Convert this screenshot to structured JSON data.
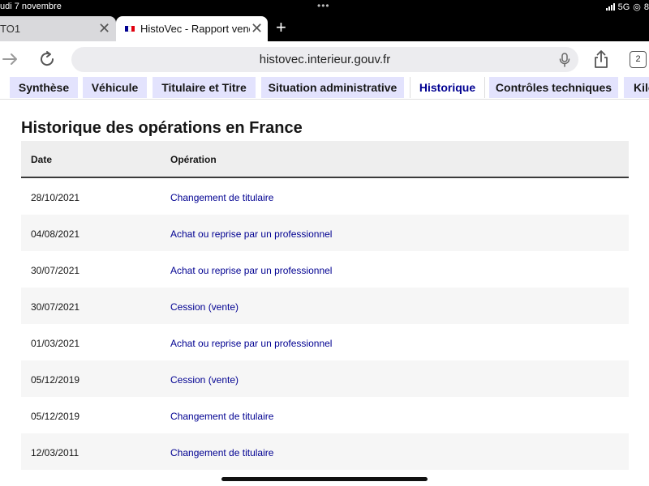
{
  "status": {
    "time_date": "udi 7 novembre",
    "network": "5G",
    "battery_fragment": "8"
  },
  "browser": {
    "tabs": [
      {
        "label": "TO1"
      },
      {
        "label": "HistoVec - Rapport vende"
      }
    ],
    "url": "histovec.interieur.gouv.fr",
    "tab_count": "2"
  },
  "nav": {
    "tabs": [
      {
        "label": "Synthèse"
      },
      {
        "label": "Véhicule"
      },
      {
        "label": "Titulaire et Titre"
      },
      {
        "label": "Situation administrative"
      },
      {
        "label": "Historique",
        "active": true
      },
      {
        "label": "Contrôles techniques"
      },
      {
        "label": "Kilo"
      }
    ]
  },
  "main": {
    "title": "Historique des opérations en France",
    "table": {
      "headers": [
        "Date",
        "Opération"
      ],
      "rows": [
        {
          "date": "28/10/2021",
          "operation": "Changement de titulaire"
        },
        {
          "date": "04/08/2021",
          "operation": "Achat ou reprise par un professionnel"
        },
        {
          "date": "30/07/2021",
          "operation": "Achat ou reprise par un professionnel"
        },
        {
          "date": "30/07/2021",
          "operation": "Cession (vente)"
        },
        {
          "date": "01/03/2021",
          "operation": "Achat ou reprise par un professionnel"
        },
        {
          "date": "05/12/2019",
          "operation": "Cession (vente)"
        },
        {
          "date": "05/12/2019",
          "operation": "Changement de titulaire"
        },
        {
          "date": "12/03/2011",
          "operation": "Changement de titulaire"
        }
      ]
    }
  },
  "colors": {
    "link": "#000091",
    "nav_tab_bg": "#e3e3fd",
    "row_alt": "#f6f6f6",
    "header_bg": "#eeeeee"
  },
  "icons": [
    "forward-icon",
    "reload-icon",
    "microphone-icon",
    "share-icon",
    "close-icon",
    "new-tab-icon",
    "tab-count-icon"
  ]
}
